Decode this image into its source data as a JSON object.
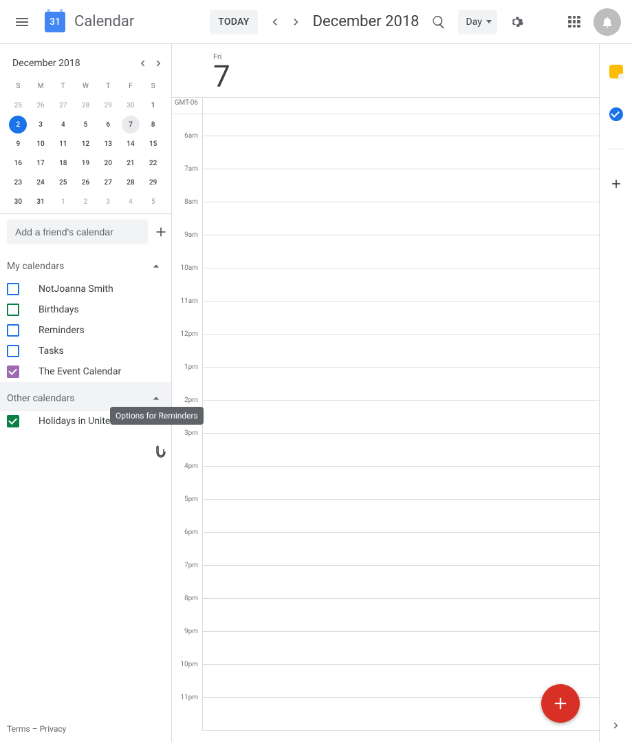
{
  "header": {
    "logo_day": "31",
    "app_name": "Calendar",
    "today_label": "TODAY",
    "date_range": "December 2018",
    "view_label": "Day"
  },
  "mini_calendar": {
    "title": "December 2018",
    "dow": [
      "S",
      "M",
      "T",
      "W",
      "T",
      "F",
      "S"
    ],
    "weeks": [
      [
        {
          "n": "25",
          "out": true
        },
        {
          "n": "26",
          "out": true
        },
        {
          "n": "27",
          "out": true
        },
        {
          "n": "28",
          "out": true
        },
        {
          "n": "29",
          "out": true
        },
        {
          "n": "30",
          "out": true
        },
        {
          "n": "1"
        }
      ],
      [
        {
          "n": "2",
          "selected": true
        },
        {
          "n": "3"
        },
        {
          "n": "4"
        },
        {
          "n": "5"
        },
        {
          "n": "6"
        },
        {
          "n": "7",
          "today": true
        },
        {
          "n": "8"
        }
      ],
      [
        {
          "n": "9"
        },
        {
          "n": "10"
        },
        {
          "n": "11"
        },
        {
          "n": "12"
        },
        {
          "n": "13"
        },
        {
          "n": "14"
        },
        {
          "n": "15"
        }
      ],
      [
        {
          "n": "16"
        },
        {
          "n": "17"
        },
        {
          "n": "18"
        },
        {
          "n": "19"
        },
        {
          "n": "20"
        },
        {
          "n": "21"
        },
        {
          "n": "22"
        }
      ],
      [
        {
          "n": "23"
        },
        {
          "n": "24"
        },
        {
          "n": "25"
        },
        {
          "n": "26"
        },
        {
          "n": "27"
        },
        {
          "n": "28"
        },
        {
          "n": "29"
        }
      ],
      [
        {
          "n": "30"
        },
        {
          "n": "31"
        },
        {
          "n": "1",
          "out": true
        },
        {
          "n": "2",
          "out": true
        },
        {
          "n": "3",
          "out": true
        },
        {
          "n": "4",
          "out": true
        },
        {
          "n": "5",
          "out": true
        }
      ]
    ]
  },
  "add_friend": {
    "placeholder": "Add a friend's calendar"
  },
  "sections": {
    "my_calendars": {
      "title": "My calendars",
      "items": [
        {
          "label": "NotJoanna Smith",
          "color": "#1a73e8",
          "checked": false
        },
        {
          "label": "Birthdays",
          "color": "#0b8043",
          "checked": false
        },
        {
          "label": "Reminders",
          "color": "#1a73e8",
          "checked": false
        },
        {
          "label": "Tasks",
          "color": "#1a73e8",
          "checked": false
        },
        {
          "label": "The Event Calendar",
          "color": "#9e69af",
          "checked": true
        }
      ]
    },
    "other_calendars": {
      "title": "Other calendars",
      "items": [
        {
          "label": "Holidays in United States",
          "color": "#0b8043",
          "checked": true
        }
      ]
    }
  },
  "tooltip": "Options for Reminders",
  "day_view": {
    "dow": "Fri",
    "day_num": "7",
    "timezone": "GMT-06",
    "hours": [
      "6am",
      "7am",
      "8am",
      "9am",
      "10am",
      "11am",
      "12pm",
      "1pm",
      "2pm",
      "3pm",
      "4pm",
      "5pm",
      "6pm",
      "7pm",
      "8pm",
      "9pm",
      "10pm",
      "11pm"
    ]
  },
  "footer": {
    "terms": "Terms",
    "sep": " – ",
    "privacy": "Privacy"
  }
}
